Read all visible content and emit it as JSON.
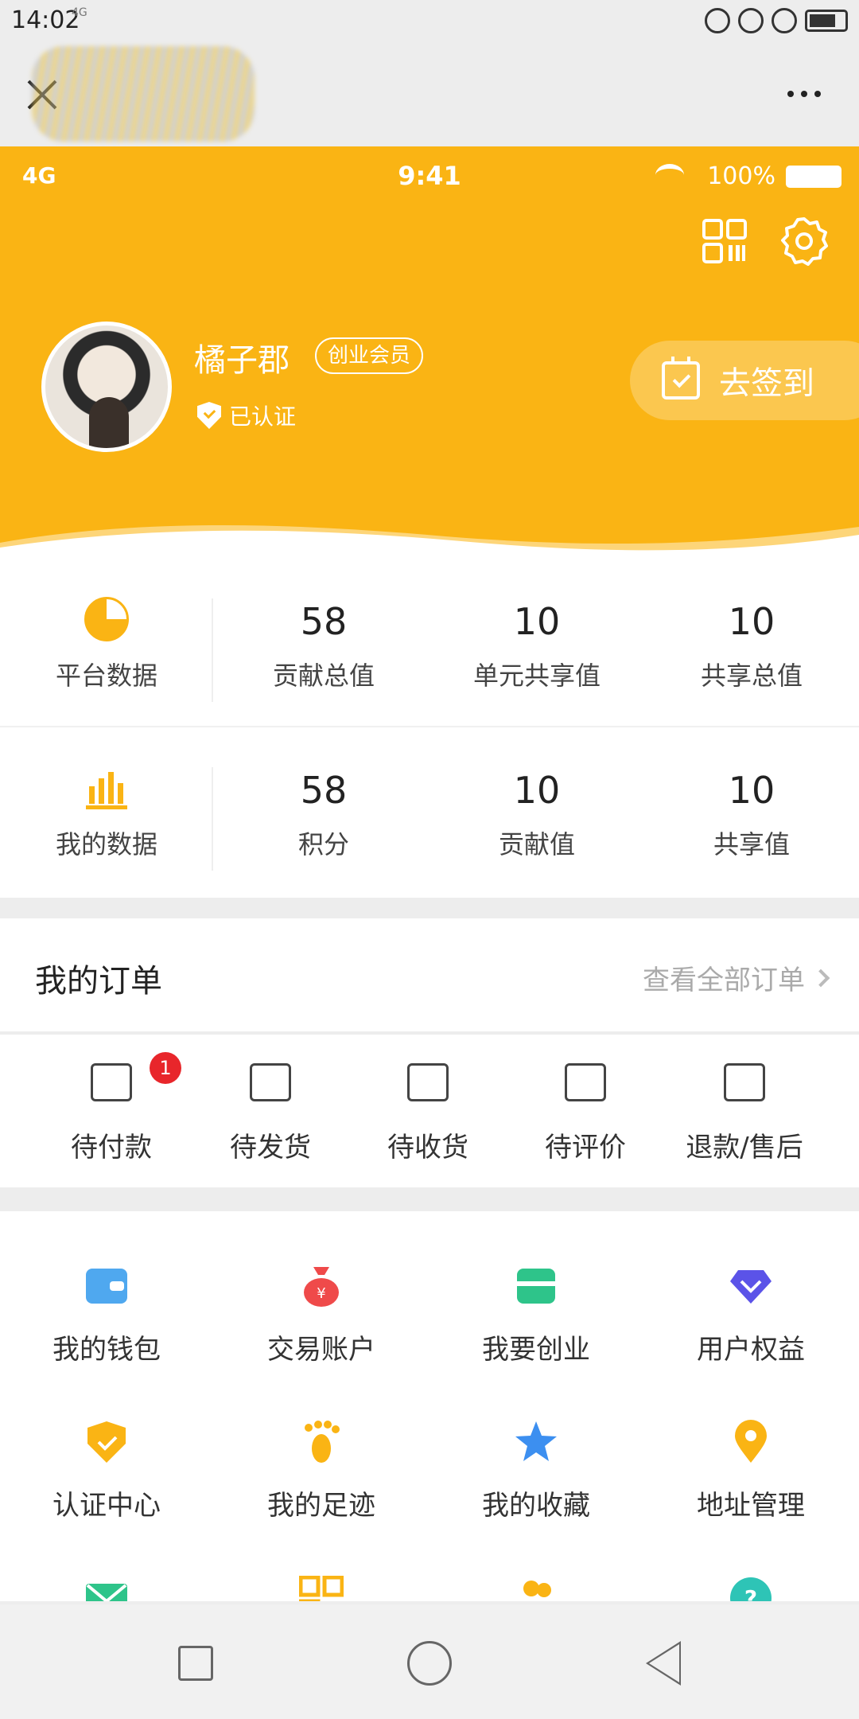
{
  "system_status": {
    "time": "14:02",
    "network": "4G"
  },
  "header": {
    "inner_status": {
      "network": "4G",
      "time": "9:41",
      "battery": "100%"
    },
    "user": {
      "name": "橘子郡",
      "member_badge": "创业会员",
      "verified": "已认证"
    },
    "signin_label": "去签到",
    "accent_color": "#fab414"
  },
  "platform_data": {
    "title": "平台数据",
    "stats": [
      {
        "value": "58",
        "label": "贡献总值"
      },
      {
        "value": "10",
        "label": "单元共享值"
      },
      {
        "value": "10",
        "label": "共享总值"
      }
    ]
  },
  "my_data": {
    "title": "我的数据",
    "stats": [
      {
        "value": "58",
        "label": "积分"
      },
      {
        "value": "10",
        "label": "贡献值"
      },
      {
        "value": "10",
        "label": "共享值"
      }
    ]
  },
  "orders": {
    "title": "我的订单",
    "view_all": "查看全部订单",
    "items": [
      {
        "label": "待付款",
        "badge": "1",
        "icon": "wallet-icon"
      },
      {
        "label": "待发货",
        "icon": "box-icon"
      },
      {
        "label": "待收货",
        "icon": "truck-icon"
      },
      {
        "label": "待评价",
        "icon": "comment-icon"
      },
      {
        "label": "退款/售后",
        "icon": "refund-icon"
      }
    ]
  },
  "tools": [
    {
      "label": "我的钱包",
      "icon": "wallet-icon",
      "color": "#4fa8ef"
    },
    {
      "label": "交易账户",
      "icon": "money-bag-icon",
      "color": "#ef4a4a"
    },
    {
      "label": "我要创业",
      "icon": "shop-icon",
      "color": "#2ec48a"
    },
    {
      "label": "用户权益",
      "icon": "diamond-icon",
      "color": "#5b53e8"
    },
    {
      "label": "认证中心",
      "icon": "shield-icon",
      "color": "#fab414"
    },
    {
      "label": "我的足迹",
      "icon": "footprint-icon",
      "color": "#fab414"
    },
    {
      "label": "我的收藏",
      "icon": "star-icon",
      "color": "#3c8ff0"
    },
    {
      "label": "地址管理",
      "icon": "location-icon",
      "color": "#fab414"
    },
    {
      "label": "",
      "icon": "mail-icon",
      "color": "#2ec48a"
    },
    {
      "label": "",
      "icon": "qrcode-icon",
      "color": "#fab414"
    },
    {
      "label": "",
      "icon": "users-icon",
      "color": "#fab414"
    },
    {
      "label": "",
      "icon": "help-icon",
      "color": "#2ec4b6"
    }
  ]
}
